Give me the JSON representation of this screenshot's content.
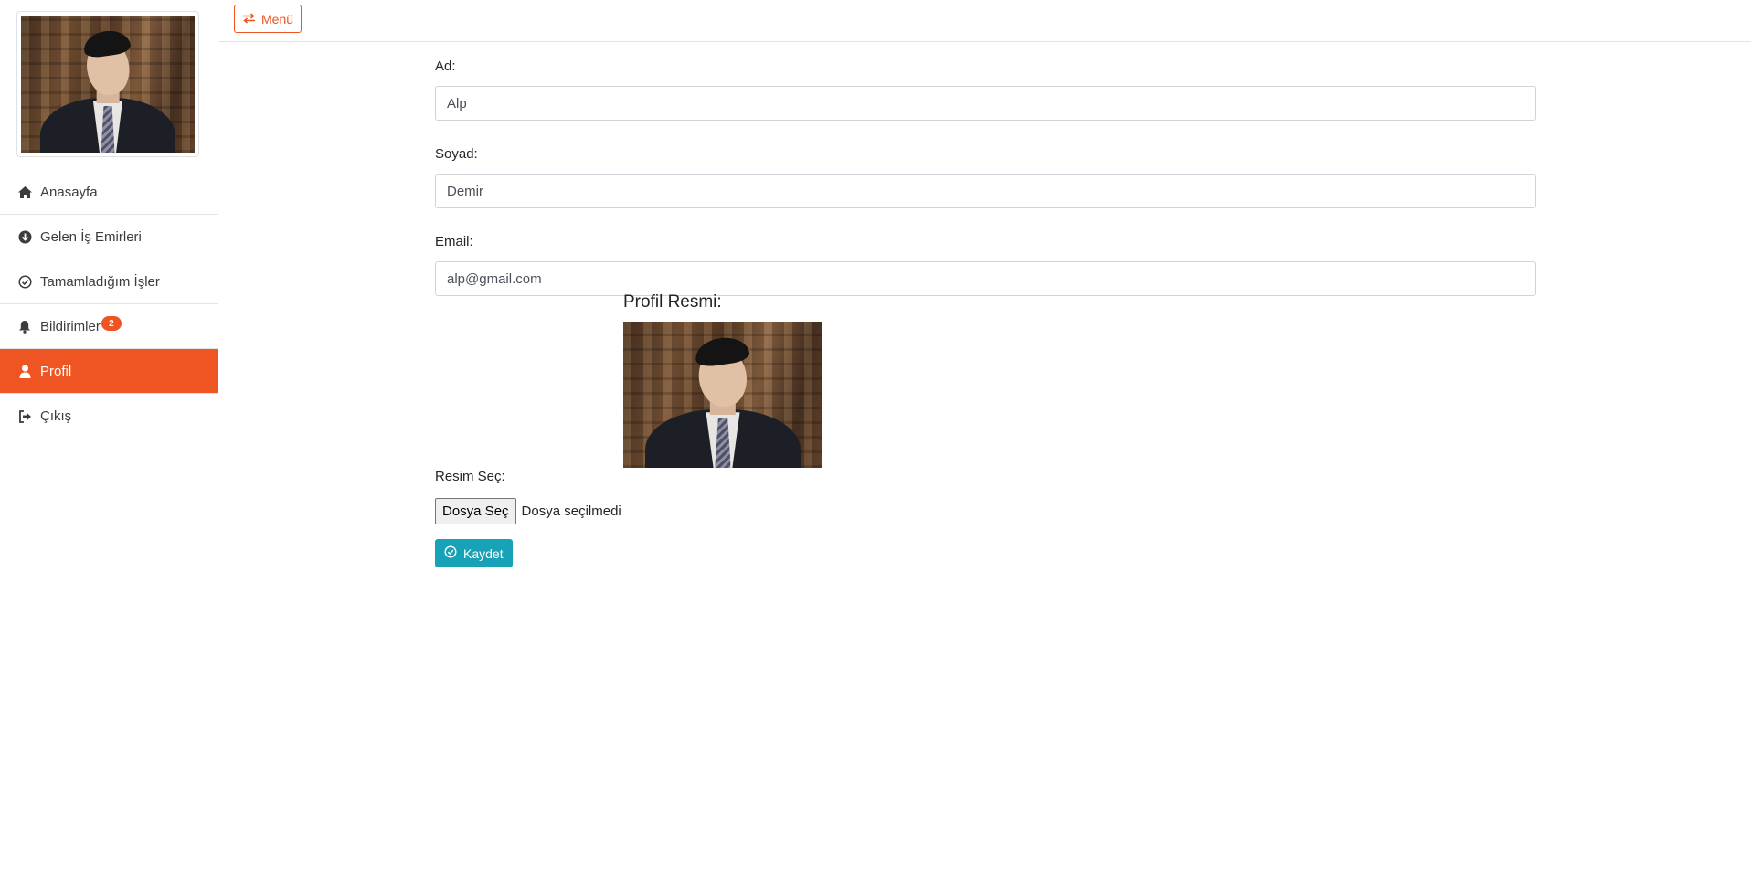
{
  "sidebar": {
    "items": [
      {
        "label": "Anasayfa",
        "icon": "home-icon"
      },
      {
        "label": "Gelen İş Emirleri",
        "icon": "arrow-circle-down-icon"
      },
      {
        "label": "Tamamladığım İşler",
        "icon": "check-circle-icon"
      },
      {
        "label": "Bildirimler",
        "icon": "bell-icon",
        "badge": "2"
      },
      {
        "label": "Profil",
        "icon": "user-icon",
        "active": true
      },
      {
        "label": "Çıkış",
        "icon": "sign-out-icon"
      }
    ]
  },
  "topbar": {
    "menu_label": "Menü"
  },
  "form": {
    "first_name_label": "Ad:",
    "first_name_value": "Alp",
    "last_name_label": "Soyad:",
    "last_name_value": "Demir",
    "email_label": "Email:",
    "email_value": "alp@gmail.com",
    "profile_picture_label": "Profil Resmi:",
    "choose_image_label": "Resim Seç:",
    "file_button_label": "Dosya Seç",
    "file_status": "Dosya seçilmedi",
    "save_label": "Kaydet"
  },
  "colors": {
    "accent": "#ee5522",
    "save": "#17a2b8"
  }
}
